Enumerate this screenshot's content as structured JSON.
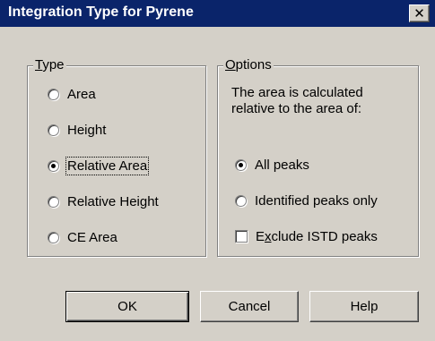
{
  "window": {
    "title": "Integration Type for Pyrene",
    "close_glyph": "✕"
  },
  "type_group": {
    "legend_ul": "T",
    "legend_rest": "ype",
    "options": [
      {
        "label": "Area",
        "checked": false
      },
      {
        "label": "Height",
        "checked": false
      },
      {
        "label": "Relative Area",
        "checked": true
      },
      {
        "label": "Relative Height",
        "checked": false
      },
      {
        "label": "CE Area",
        "checked": false
      }
    ]
  },
  "options_group": {
    "legend_ul": "O",
    "legend_rest": "ptions",
    "description_line1": "The area is calculated",
    "description_line2": "relative to the area of:",
    "radios": [
      {
        "label": "All peaks",
        "checked": true
      },
      {
        "label": "Identified peaks only",
        "checked": false
      }
    ],
    "exclude_checkbox": {
      "label_pre": "E",
      "label_ul": "x",
      "label_post": "clude ISTD peaks",
      "checked": false
    }
  },
  "buttons": {
    "ok": "OK",
    "cancel": "Cancel",
    "help": "Help"
  }
}
